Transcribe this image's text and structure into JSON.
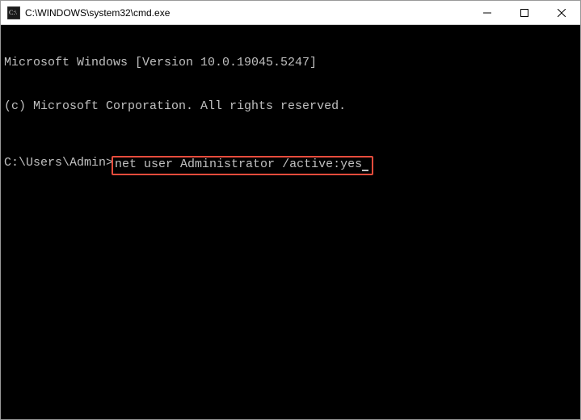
{
  "window": {
    "title": "C:\\WINDOWS\\system32\\cmd.exe"
  },
  "terminal": {
    "banner_line1": "Microsoft Windows [Version 10.0.19045.5247]",
    "banner_line2": "(c) Microsoft Corporation. All rights reserved.",
    "prompt": "C:\\Users\\Admin>",
    "command": "net user Administrator /active:yes"
  }
}
